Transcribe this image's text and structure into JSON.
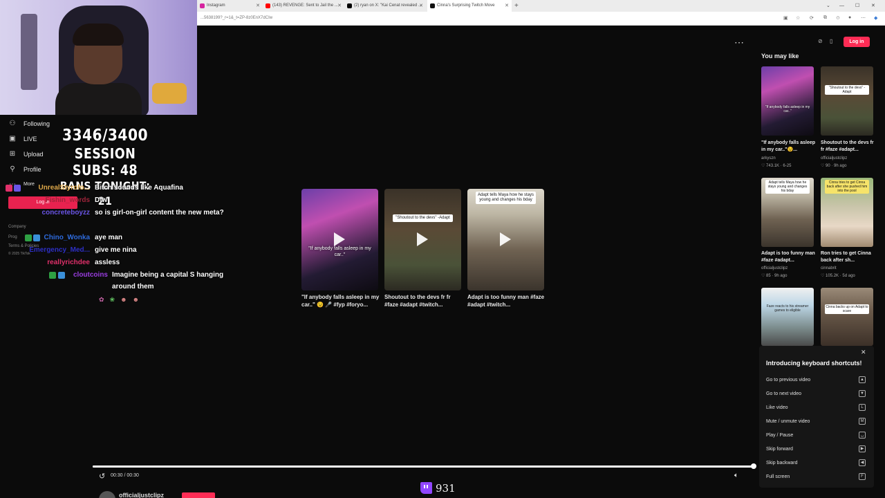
{
  "browser": {
    "tabs": [
      {
        "label": "Instagram",
        "left": 0
      },
      {
        "label": "(143) REVENGE: Sent to Jail the ...",
        "left": 0
      },
      {
        "label": "(2) ryan on X: \"Kai Cenat revealed ...",
        "left": 0
      },
      {
        "label": "Cinna's Surprising Twitch Move",
        "left": 0
      }
    ],
    "url": "...5638199?_r=1&_t=ZP-8z0EnX7dCIw"
  },
  "overlay": {
    "goal": "3346/3400",
    "session_subs": "SESSION SUBS: 48",
    "bans": "BANS TONIGHT: 21"
  },
  "nav": {
    "following": "Following",
    "live": "LIVE",
    "upload": "Upload",
    "profile": "Profile",
    "more": "More",
    "login": "Log in",
    "company": "Company",
    "program": "Prog",
    "terms": "Terms & Policies",
    "copyright": "© 2025 TikTok"
  },
  "chat": [
    {
      "name": "UnrealStyrofo...",
      "color": "#e0a94a",
      "msg": "Bitch sounds like Aquafina"
    },
    {
      "name": "Fishin_words",
      "color": "#a0243a",
      "msg": "Dfw"
    },
    {
      "name": "concreteboyzz",
      "color": "#6a55e6",
      "msg": "so is girl-on-girl content the new meta?"
    },
    {
      "name": "Chino_Wonka",
      "color": "#2e6bdc",
      "msg": "aye man"
    },
    {
      "name": "Emergency_Med...",
      "color": "#2d2fc4",
      "msg": "give me nina"
    },
    {
      "name": "reallyrichdee",
      "color": "#e0306a",
      "msg": "assless"
    },
    {
      "name": "cloutcoins",
      "color": "#9a3de0",
      "msg": "Imagine being a capital S hanging around them"
    }
  ],
  "videos": [
    {
      "caption": "\"If anybody falls asleep in my car..\"",
      "title": "\"If anybody falls asleep in my car..\" 😉 🎤 #fyp #foryo..."
    },
    {
      "caption": "\"Shoutout to the devs\" -Adapt",
      "title": "Shoutout to the devs fr fr #faze #adapt #twitch..."
    },
    {
      "caption": "Adapt tells Maya how he stays young and changes his bday",
      "title": "Adapt is too funny man #faze #adapt #twitch..."
    }
  ],
  "sidebar": {
    "title": "You may like",
    "login": "Log in",
    "items": [
      {
        "thumb": "\"If anybody falls asleep in my car..\"",
        "caption": "\"If anybody falls asleep in my car..\"😉...",
        "author": "arkyszn",
        "meta": "♡ 743.1K · 6-25"
      },
      {
        "thumb": "\"Shoutout to the devs\" -Adapt",
        "caption": "Shoutout to the devs fr fr #faze #adapt...",
        "author": "officialjustclipz",
        "meta": "♡ 90 · 9h ago"
      },
      {
        "thumb": "Adapt tells Maya how he stays young and changes his bday",
        "caption": "Adapt is too funny man #faze #adapt...",
        "author": "officialjustclipz",
        "meta": "♡ 85 · 9h ago"
      },
      {
        "thumb": "Cinna tries to get Cinna back after she pushed him into the pool",
        "caption": "Ron tries to get Cinna back after sh...",
        "author": "cinnabrit",
        "meta": "♡ 105.2K · 5d ago"
      },
      {
        "thumb": "Faze reacts to his streamer games to eligible",
        "caption": "",
        "author": "",
        "meta": ""
      },
      {
        "thumb": "Cinna backs up on Adapt to scare",
        "caption": "",
        "author": "",
        "meta": ""
      }
    ]
  },
  "shortcuts": {
    "title": "Introducing keyboard shortcuts!",
    "rows": [
      {
        "label": "Go to previous video",
        "key": "▲"
      },
      {
        "label": "Go to next video",
        "key": "▼"
      },
      {
        "label": "Like video",
        "key": "L"
      },
      {
        "label": "Mute / unmute video",
        "key": "M"
      },
      {
        "label": "Play / Pause",
        "key": "␣"
      },
      {
        "label": "Skip forward",
        "key": "▶"
      },
      {
        "label": "Skip backward",
        "key": "◀"
      },
      {
        "label": "Full screen",
        "key": "F"
      }
    ]
  },
  "player": {
    "time": "00:30 / 00:30",
    "progress_pct": 100,
    "author": "officialjustclipz"
  },
  "twitch": {
    "sub_count": "931"
  },
  "colors": {
    "accent": "#fe2c55",
    "twitch": "#9146ff"
  }
}
